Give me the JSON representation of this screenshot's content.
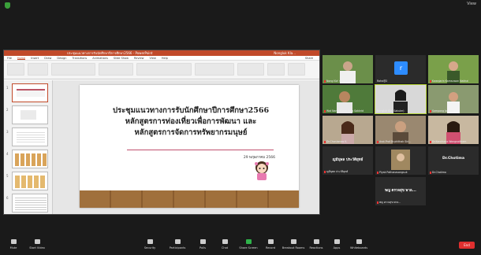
{
  "topbar": {
    "view_label": "View"
  },
  "ppt": {
    "title": "ประชุมแนวทางการรับนักศึกษาปีการศึกษา2566 - PowerPoint",
    "user": "Nongluk Kla...",
    "menu": [
      "File",
      "Home",
      "Insert",
      "Draw",
      "Design",
      "Transitions",
      "Animations",
      "Slide Show",
      "Review",
      "View",
      "Help",
      "Share"
    ]
  },
  "slide": {
    "title_line1": "ประชุมแนวทางการรับนักศึกษาปีการศึกษา2566",
    "title_line2": "หลักสูตรการท่องเที่ยวเพื่อการพัฒนา และ",
    "title_line3": "หลักสูตรการจัดการทรัพยากรมนุษย์",
    "date": "29 พฤษภาคม 2566"
  },
  "thumbs": [
    "1",
    "2",
    "3",
    "4",
    "5",
    "6"
  ],
  "participants": [
    {
      "name": "Nong Kla' sak Jaiman"
    },
    {
      "name": "Raha@2",
      "initial": "r"
    },
    {
      "name": "Kwanjarin Kamsuwan Nakhai"
    },
    {
      "name": "Wat Nang Kham Tong Sakkrid"
    },
    {
      "name": "Nongluk Kla (Sakuler)"
    },
    {
      "name": "Sompong Jaiman"
    },
    {
      "name": "Dr.Chonlamas K."
    },
    {
      "name": "Asst.Prof.Dr.phithak Siri..."
    },
    {
      "name": "Dr.Kanchana Wongnaitham"
    },
    {
      "name": "ญมีนุพล  ประวัติยุทธ์",
      "sub": "ญมีนุพล  ประวัติยุทธ์"
    },
    {
      "name": "Piyak Pathanasangsuk"
    },
    {
      "name": "Dr.Chotima",
      "sub": "Dr.Chotima"
    },
    {
      "name": "พญ ตรวจสุข พาล...",
      "sub": "พญ ตรวจสุข พาล..."
    }
  ],
  "toolbar": {
    "mute": "Mute",
    "video": "Start Video",
    "security": "Security",
    "participants": "Participants",
    "participants_count": "13",
    "polls": "Polls",
    "chat": "Chat",
    "share": "Share Screen",
    "record": "Record",
    "breakout": "Breakout Rooms",
    "reactions": "Reactions",
    "apps": "Apps",
    "whiteboards": "Whiteboards",
    "end": "End"
  },
  "colors": {
    "ppt_accent": "#c14a2a",
    "active_speaker": "#b5d334",
    "end": "#e02f2f",
    "zoom_blue": "#2d8cff"
  }
}
